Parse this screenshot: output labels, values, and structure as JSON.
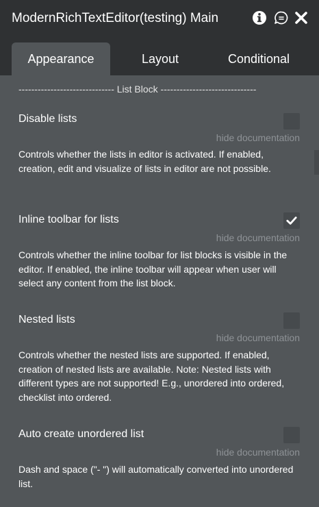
{
  "window": {
    "title": "ModernRichTextEditor(testing) Main",
    "icons": [
      "info-icon",
      "comment-icon",
      "close-icon"
    ]
  },
  "tabs": [
    {
      "label": "Appearance",
      "active": true
    },
    {
      "label": "Layout",
      "active": false
    },
    {
      "label": "Conditional",
      "active": false
    }
  ],
  "section": {
    "divider": "------------------------------ List Block ------------------------------"
  },
  "properties": [
    {
      "label": "Disable lists",
      "checked": false,
      "hide_doc": "hide documentation",
      "description": "Controls whether the lists in editor is activated. If enabled, creation, edit and visualize of lists in editor are not possible."
    },
    {
      "label": "Inline toolbar for lists",
      "checked": true,
      "hide_doc": "hide documentation",
      "description": "Controls whether the inline toolbar for list blocks is visible in the editor. If enabled, the inline toolbar will appear when user will select any content from the list block."
    },
    {
      "label": "Nested lists",
      "checked": false,
      "hide_doc": "hide documentation",
      "description": "Controls whether the nested lists are supported. If enabled, creation of nested lists are available. Note: Nested lists with different types are not supported! E.g., unordered into ordered, checklist into ordered."
    },
    {
      "label": "Auto create unordered list",
      "checked": false,
      "hide_doc": "hide documentation",
      "description": "Dash and space (\"- \") will automatically converted into unordered list."
    }
  ],
  "colors": {
    "panel_bg": "#525659",
    "header_bg": "#2f3133",
    "checkbox_bg": "#464a4d",
    "muted_text": "#8e9296"
  }
}
